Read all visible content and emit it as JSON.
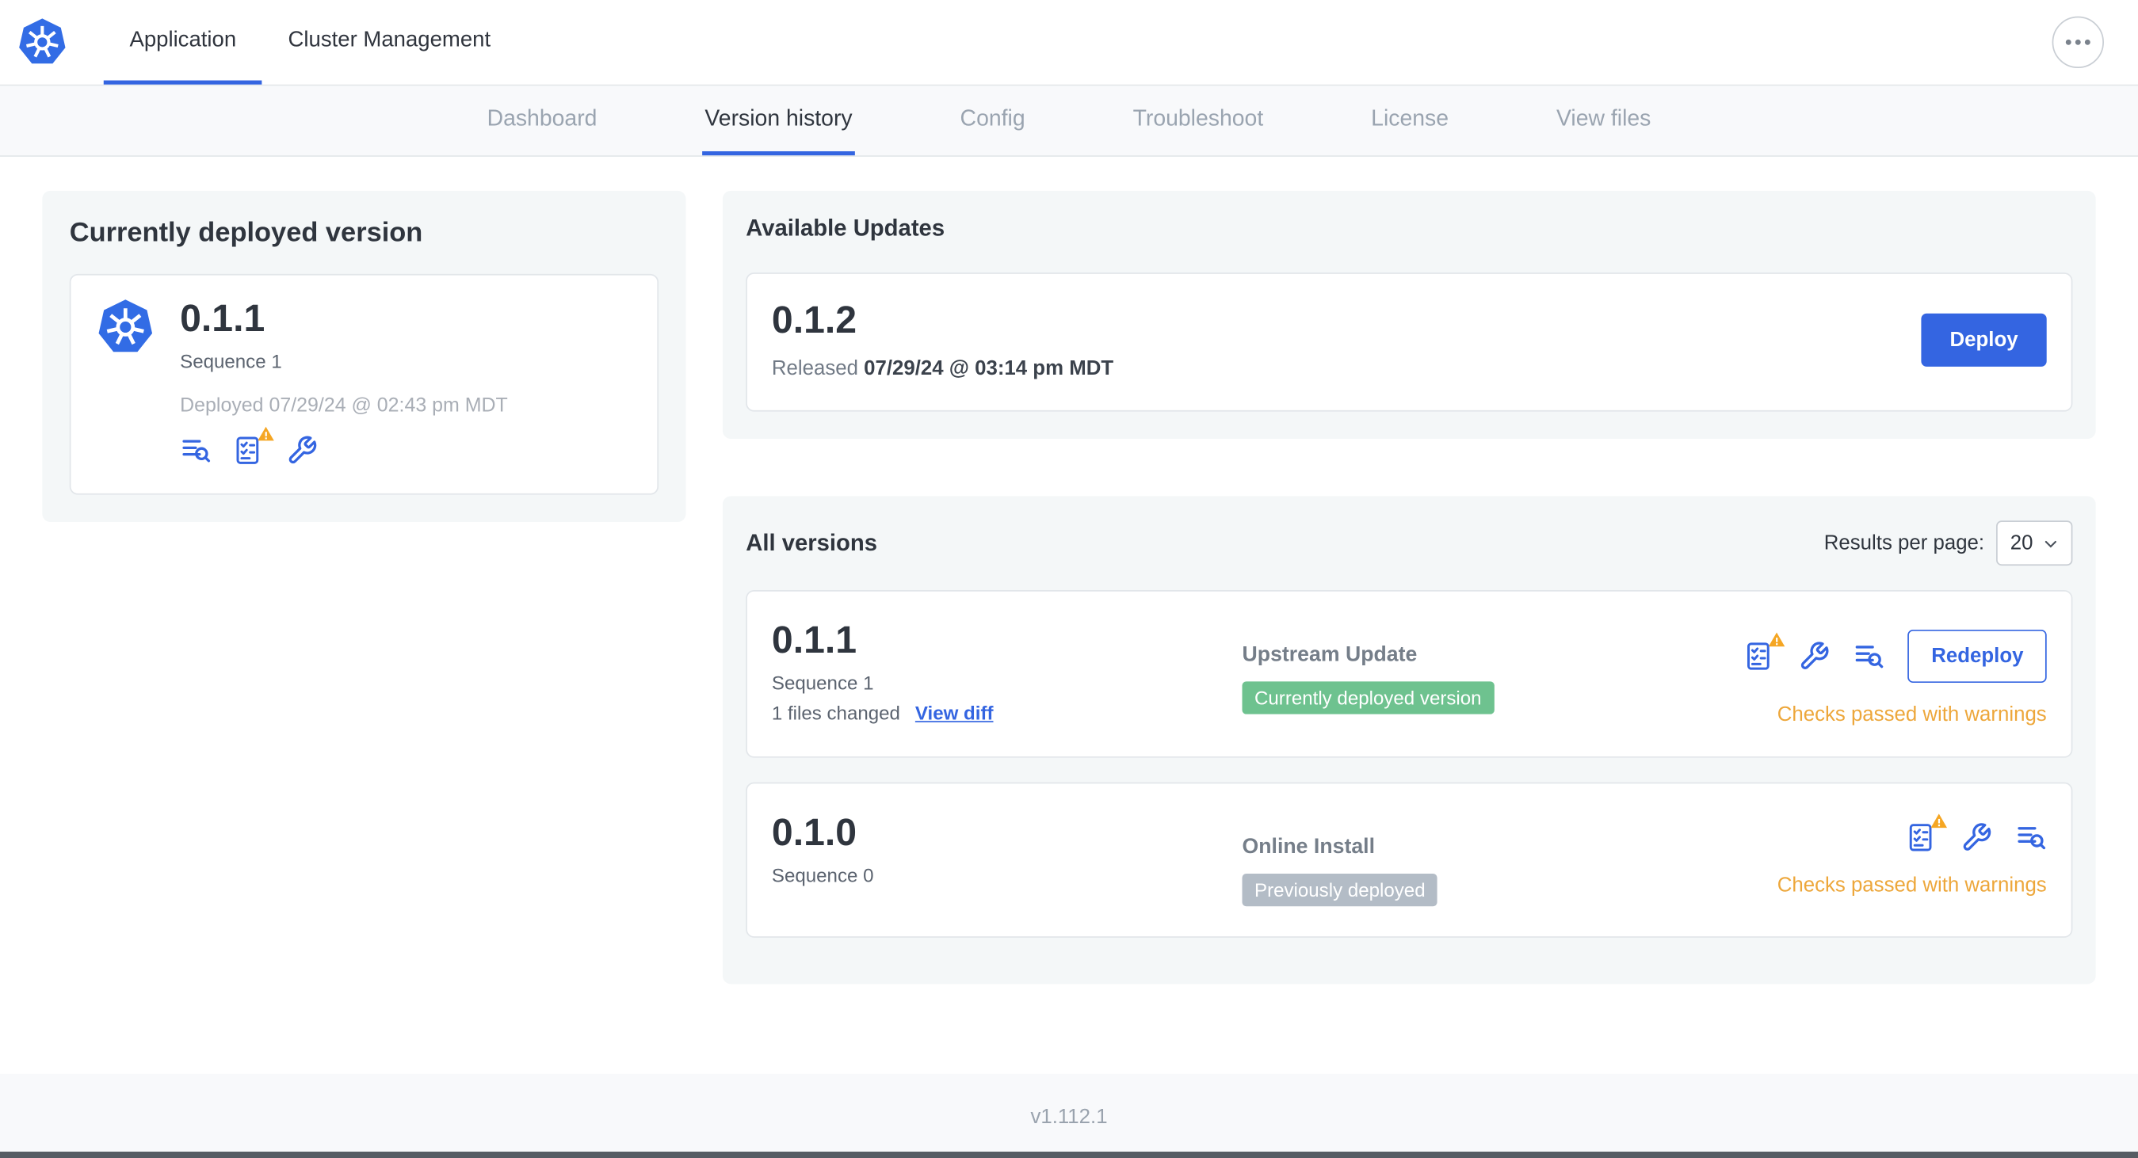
{
  "header": {
    "tabs": [
      {
        "label": "Application",
        "active": true
      },
      {
        "label": "Cluster Management",
        "active": false
      }
    ]
  },
  "subnav": {
    "items": [
      {
        "label": "Dashboard",
        "active": false
      },
      {
        "label": "Version history",
        "active": true
      },
      {
        "label": "Config",
        "active": false
      },
      {
        "label": "Troubleshoot",
        "active": false
      },
      {
        "label": "License",
        "active": false
      },
      {
        "label": "View files",
        "active": false
      }
    ]
  },
  "current_version": {
    "title": "Currently deployed version",
    "version": "0.1.1",
    "sequence": "Sequence 1",
    "deployed": "Deployed 07/29/24 @ 02:43 pm MDT"
  },
  "available_updates": {
    "title": "Available Updates",
    "version": "0.1.2",
    "released_prefix": "Released",
    "released_date": "07/29/24 @ 03:14 pm MDT",
    "deploy_label": "Deploy"
  },
  "all_versions": {
    "title": "All versions",
    "results_per_page_label": "Results per page:",
    "results_per_page_value": "20",
    "rows": [
      {
        "version": "0.1.1",
        "sequence": "Sequence 1",
        "files_changed": "1 files changed",
        "view_diff_label": "View diff",
        "source": "Upstream Update",
        "badge": "Currently deployed version",
        "action_label": "Redeploy",
        "checks": "Checks passed with warnings"
      },
      {
        "version": "0.1.0",
        "sequence": "Sequence 0",
        "source": "Online Install",
        "badge": "Previously deployed",
        "checks": "Checks passed with warnings"
      }
    ]
  },
  "footer": {
    "version": "v1.112.1"
  },
  "icons": [
    "kubernetes-logo",
    "ellipsis-icon",
    "logs-icon",
    "preflight-checks-icon",
    "warning-triangle-icon",
    "wrench-icon",
    "chevron-down-icon"
  ],
  "colors": {
    "accent_blue": "#3465e1",
    "k8s_blue": "#326ce5",
    "badge_green": "#6ec28f",
    "badge_gray": "#b3bcc6",
    "warning_orange": "#eda73b"
  }
}
